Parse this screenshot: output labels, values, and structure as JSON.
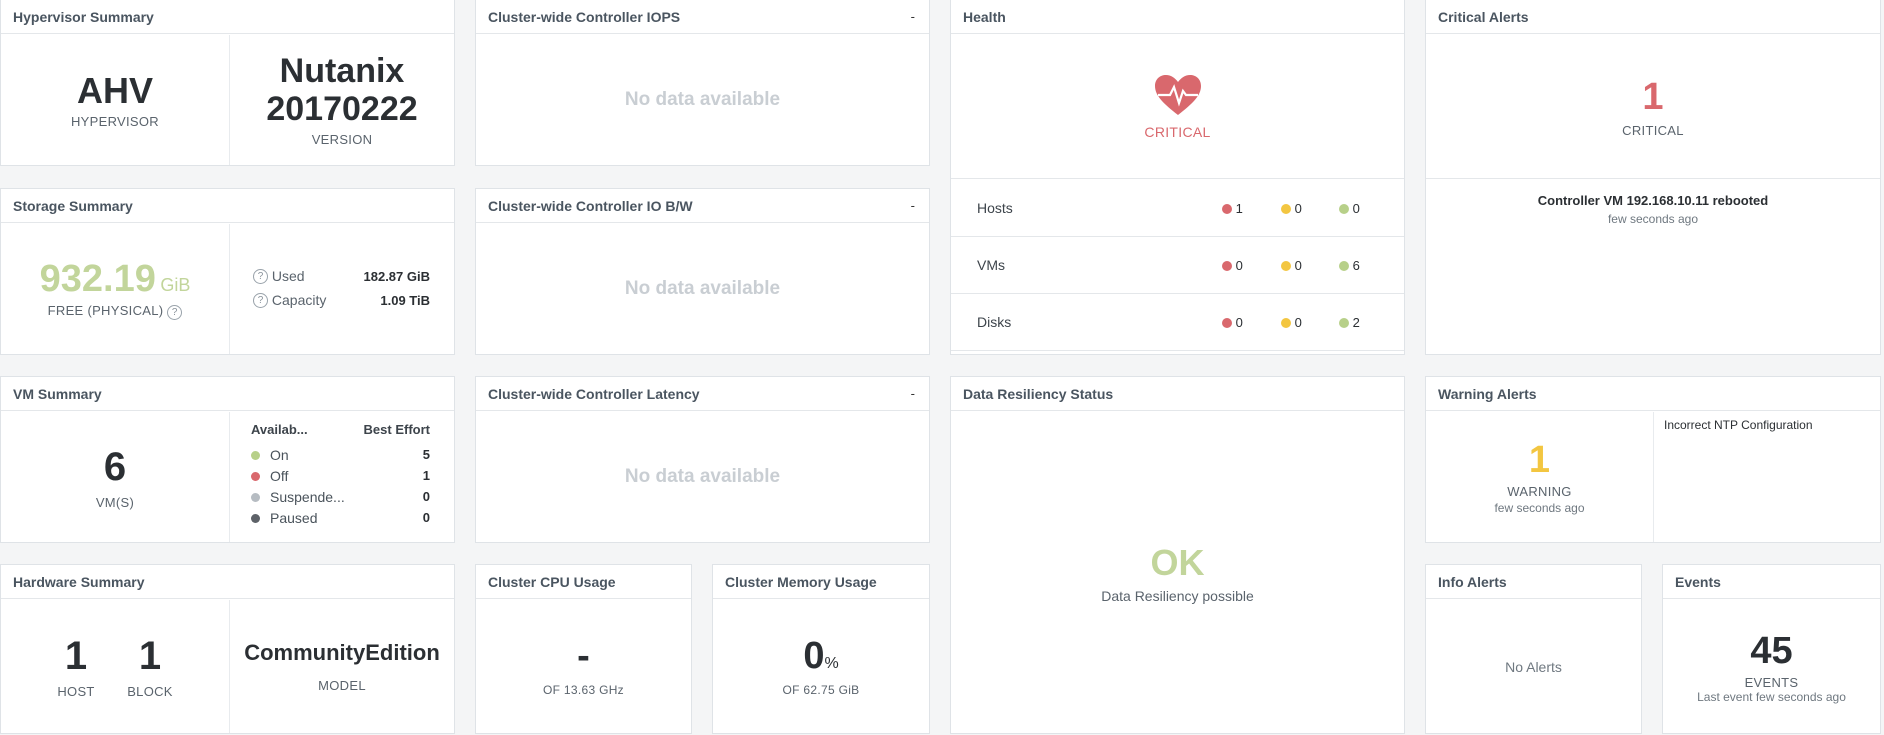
{
  "hypervisor": {
    "title": "Hypervisor Summary",
    "type": "AHV",
    "type_label": "HYPERVISOR",
    "version_line1": "Nutanix",
    "version_line2": "20170222",
    "version_label": "VERSION"
  },
  "storage": {
    "title": "Storage Summary",
    "free_value": "932.19",
    "free_unit": "GiB",
    "free_label": "FREE (PHYSICAL)",
    "used_label": "Used",
    "used_value": "182.87 GiB",
    "capacity_label": "Capacity",
    "capacity_value": "1.09 TiB"
  },
  "vm_summary": {
    "title": "VM Summary",
    "count": "6",
    "count_label": "VM(S)",
    "col_availability": "Availab...",
    "col_best_effort": "Best Effort",
    "rows": [
      {
        "label": "On",
        "value": "5",
        "color": "#b7d089"
      },
      {
        "label": "Off",
        "value": "1",
        "color": "#d9686d"
      },
      {
        "label": "Suspende...",
        "value": "0",
        "color": "#b6bcc2"
      },
      {
        "label": "Paused",
        "value": "0",
        "color": "#5d6268"
      }
    ]
  },
  "hardware": {
    "title": "Hardware Summary",
    "hosts": "1",
    "hosts_label": "HOST",
    "blocks": "1",
    "blocks_label": "BLOCK",
    "model": "CommunityEdition",
    "model_label": "MODEL"
  },
  "iops": {
    "title": "Cluster-wide Controller IOPS",
    "menu": "-",
    "no_data": "No data available"
  },
  "iobw": {
    "title": "Cluster-wide Controller IO B/W",
    "menu": "-",
    "no_data": "No data available"
  },
  "latency": {
    "title": "Cluster-wide Controller Latency",
    "menu": "-",
    "no_data": "No data available"
  },
  "cpu": {
    "title": "Cluster CPU Usage",
    "value": "-",
    "sub": "OF 13.63 GHz"
  },
  "memory": {
    "title": "Cluster Memory Usage",
    "value": "0",
    "unit": "%",
    "sub": "OF 62.75 GiB"
  },
  "health": {
    "title": "Health",
    "status": "CRITICAL",
    "status_color": "#d9686d",
    "rows": [
      {
        "label": "Hosts",
        "red": "1",
        "yellow": "0",
        "green": "0"
      },
      {
        "label": "VMs",
        "red": "0",
        "yellow": "0",
        "green": "6"
      },
      {
        "label": "Disks",
        "red": "0",
        "yellow": "0",
        "green": "2"
      }
    ]
  },
  "resiliency": {
    "title": "Data Resiliency Status",
    "status": "OK",
    "sub": "Data Resiliency possible"
  },
  "critical_alerts": {
    "title": "Critical Alerts",
    "count": "1",
    "label": "CRITICAL",
    "message": "Controller VM 192.168.10.11 rebooted",
    "time": "few seconds ago"
  },
  "warning_alerts": {
    "title": "Warning Alerts",
    "count": "1",
    "label": "WARNING",
    "time": "few seconds ago",
    "message": "Incorrect NTP Configuration"
  },
  "info_alerts": {
    "title": "Info Alerts",
    "empty": "No Alerts"
  },
  "events": {
    "title": "Events",
    "count": "45",
    "label": "EVENTS",
    "sub": "Last event few seconds ago"
  }
}
